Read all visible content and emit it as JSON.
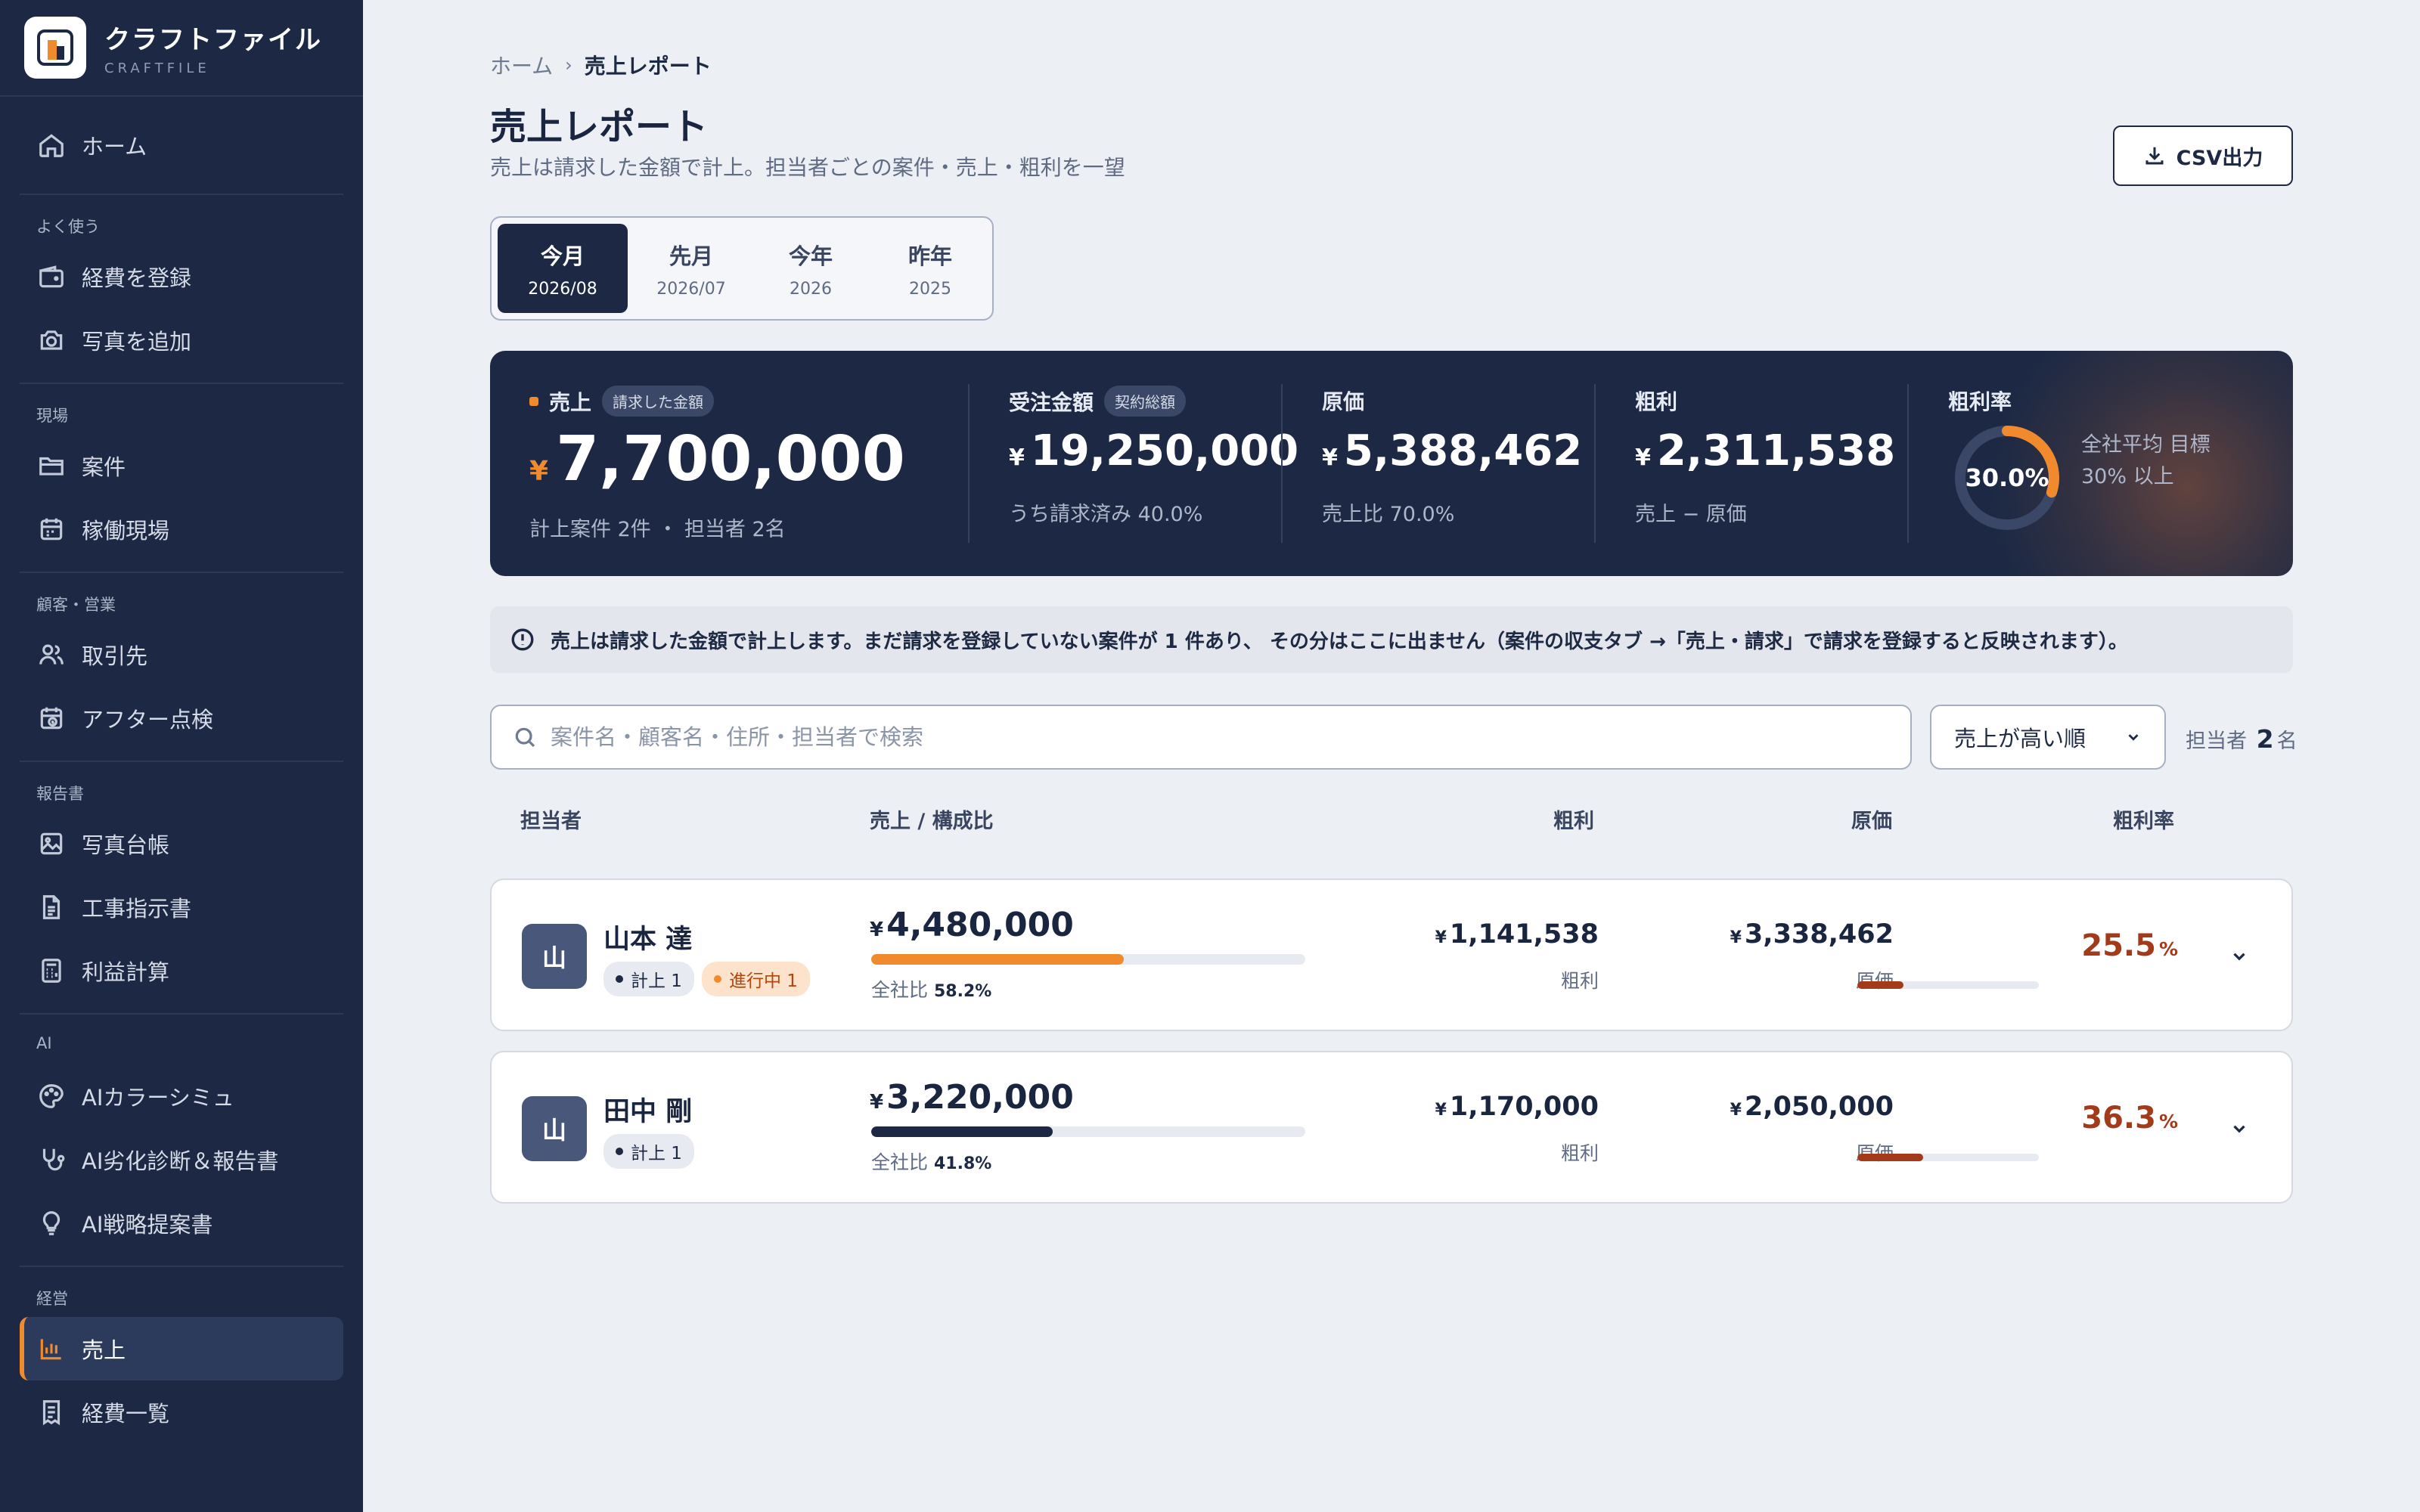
{
  "brand": {
    "name": "クラフトファイル",
    "sub": "CRAFTFILE"
  },
  "sidebar": {
    "home": "ホーム",
    "sections": [
      {
        "label": "よく使う",
        "items": [
          {
            "label": "経費を登録",
            "icon": "wallet-icon"
          },
          {
            "label": "写真を追加",
            "icon": "camera-icon"
          }
        ]
      },
      {
        "label": "現場",
        "items": [
          {
            "label": "案件",
            "icon": "folder-icon"
          },
          {
            "label": "稼働現場",
            "icon": "calendar-icon"
          }
        ]
      },
      {
        "label": "顧客・営業",
        "items": [
          {
            "label": "取引先",
            "icon": "users-icon"
          },
          {
            "label": "アフター点検",
            "icon": "calendar-check-icon"
          }
        ]
      },
      {
        "label": "報告書",
        "items": [
          {
            "label": "写真台帳",
            "icon": "image-icon"
          },
          {
            "label": "工事指示書",
            "icon": "document-icon"
          },
          {
            "label": "利益計算",
            "icon": "calculator-icon"
          }
        ]
      },
      {
        "label": "AI",
        "items": [
          {
            "label": "AIカラーシミュ",
            "icon": "palette-icon"
          },
          {
            "label": "AI劣化診断＆報告書",
            "icon": "stethoscope-icon"
          },
          {
            "label": "AI戦略提案書",
            "icon": "lightbulb-icon"
          }
        ]
      },
      {
        "label": "経営",
        "items": [
          {
            "label": "売上",
            "icon": "bar-chart-icon",
            "active": true
          },
          {
            "label": "経費一覧",
            "icon": "receipt-icon"
          }
        ]
      }
    ]
  },
  "breadcrumb": {
    "home": "ホーム",
    "sep": "›",
    "current": "売上レポート"
  },
  "page": {
    "title": "売上レポート",
    "subtitle": "売上は請求した金額で計上。担当者ごとの案件・売上・粗利を一望"
  },
  "csv_button": "CSV出力",
  "periods": [
    {
      "label": "今月",
      "date": "2026/08",
      "active": true
    },
    {
      "label": "先月",
      "date": "2026/07"
    },
    {
      "label": "今年",
      "date": "2026"
    },
    {
      "label": "昨年",
      "date": "2025"
    }
  ],
  "kpi": {
    "accent": "#f08a2c",
    "sales": {
      "label": "売上",
      "badge": "請求した金額",
      "currency": "¥",
      "value": "7,700,000",
      "sub": "計上案件 2件 ・ 担当者 2名"
    },
    "orders": {
      "label": "受注金額",
      "badge": "契約総額",
      "currency": "¥",
      "value": "19,250,000",
      "sub": "うち請求済み 40.0%"
    },
    "cost": {
      "label": "原価",
      "currency": "¥",
      "value": "5,388,462",
      "sub": "売上比 70.0%"
    },
    "profit": {
      "label": "粗利",
      "currency": "¥",
      "value": "2,311,538",
      "sub": "売上 − 原価"
    },
    "margin": {
      "label": "粗利率",
      "value": "30.0%",
      "fraction": 0.3,
      "note": "全社平均 目標 30% 以上"
    }
  },
  "notice": "売上は請求した金額で計上します。まだ請求を登録していない案件が 1 件あり、 その分はここに出ません（案件の収支タブ →「売上・請求」で請求を登録すると反映されます）。",
  "search": {
    "placeholder": "案件名・顧客名・住所・担当者で検索",
    "value": ""
  },
  "sort": {
    "selected": "売上が高い順"
  },
  "count": {
    "prefix": "担当者",
    "value": "2",
    "suffix": "名"
  },
  "table": {
    "headers": {
      "person": "担当者",
      "sales": "売上 / 構成比",
      "profit": "粗利",
      "cost": "原価",
      "margin": "粗利率"
    },
    "rows": [
      {
        "avatar": "山",
        "name": "山本 達",
        "tags": [
          {
            "text": "計上 1",
            "style": "gray"
          },
          {
            "text": "進行中 1",
            "style": "orange"
          }
        ],
        "currency": "¥",
        "sales": "4,480,000",
        "share_label": "全社比",
        "share": "58.2%",
        "share_fraction": 0.582,
        "bar_color": "#f08a2c",
        "profit": "1,141,538",
        "profit_label": "粗利",
        "cost": "3,338,462",
        "cost_label": "原価",
        "margin": "25.5",
        "margin_unit": "%",
        "margin_fraction": 0.255
      },
      {
        "avatar": "山",
        "name": "田中 剛",
        "tags": [
          {
            "text": "計上 1",
            "style": "gray"
          }
        ],
        "currency": "¥",
        "sales": "3,220,000",
        "share_label": "全社比",
        "share": "41.8%",
        "share_fraction": 0.418,
        "bar_color": "#1d2944",
        "profit": "1,170,000",
        "profit_label": "粗利",
        "cost": "2,050,000",
        "cost_label": "原価",
        "margin": "36.3",
        "margin_unit": "%",
        "margin_fraction": 0.363
      }
    ]
  }
}
